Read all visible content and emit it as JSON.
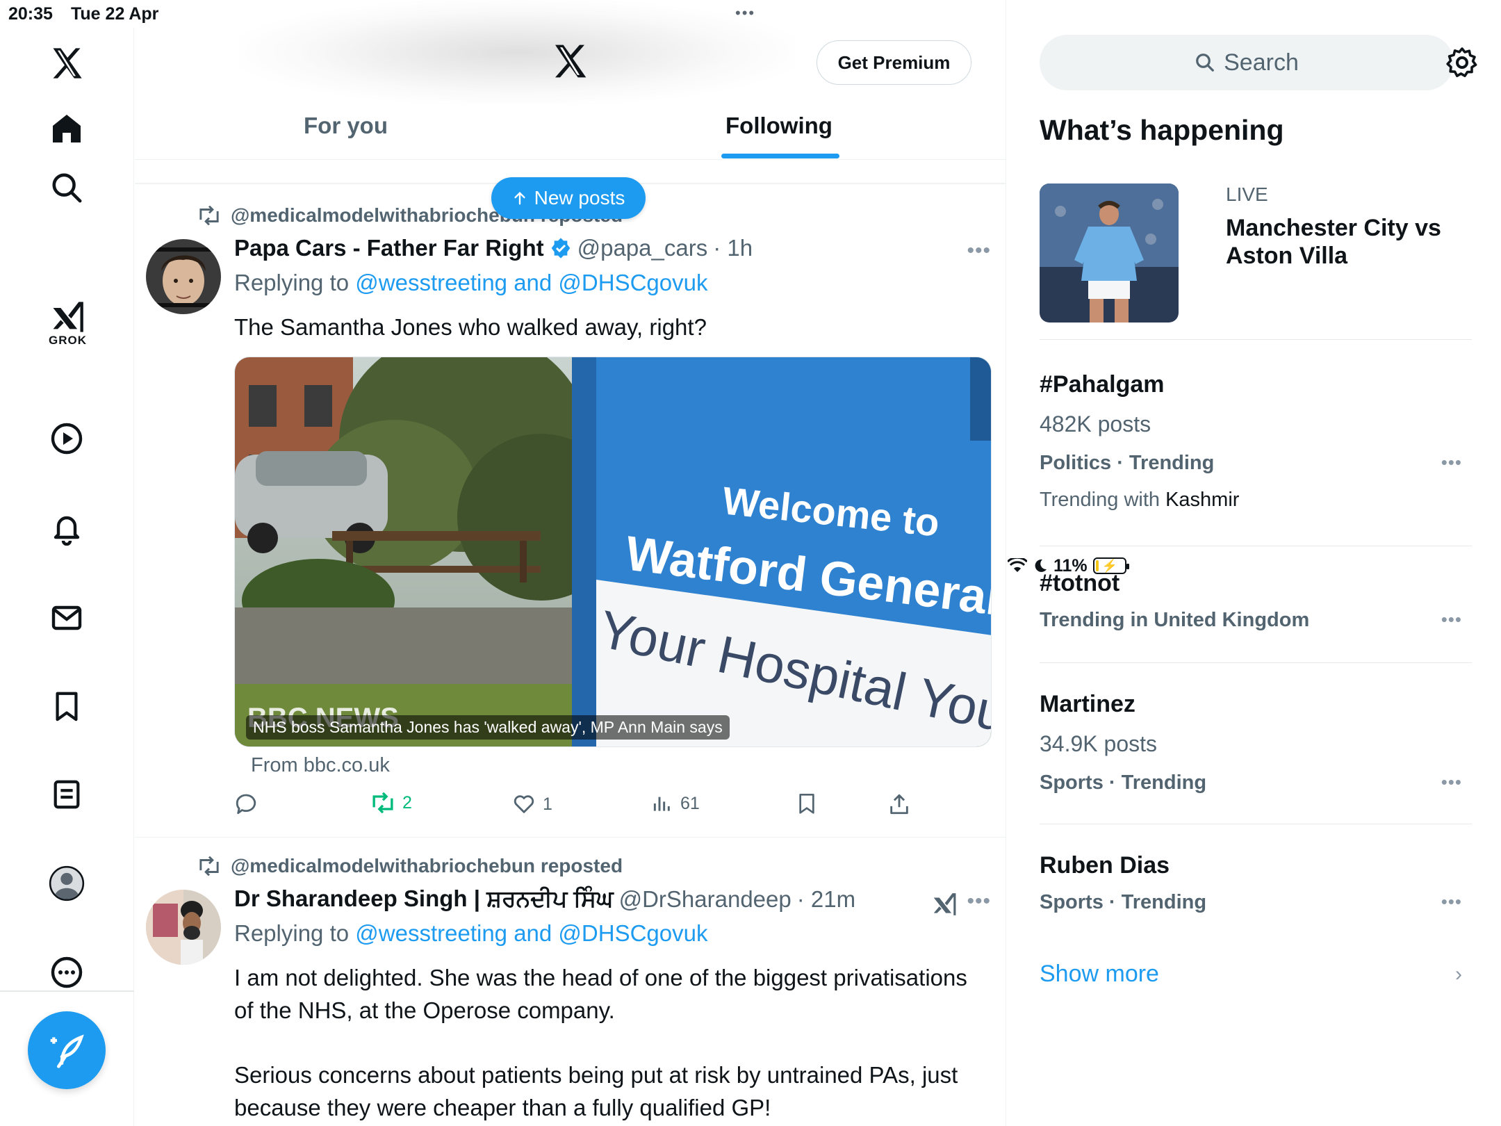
{
  "status_bar": {
    "time": "20:35",
    "date": "Tue 22 Apr",
    "battery": "11%",
    "battery_level": 0.11
  },
  "left_nav": {
    "grok_label": "GROK"
  },
  "header": {
    "get_premium": "Get Premium",
    "tabs": [
      {
        "label": "For you",
        "active": false
      },
      {
        "label": "Following",
        "active": true
      }
    ],
    "new_posts": "New posts"
  },
  "tweets": [
    {
      "reposted_by": "@medicalmodelwithabriochebun reposted",
      "name": "Papa Cars - Father Far Right",
      "verified": true,
      "handle": "@papa_cars",
      "time": "· 1h",
      "replying_prefix": "Replying to",
      "replying_to": "@wesstreeting and @DHSCgovuk",
      "text": "The Samantha Jones who walked away, right?",
      "media": {
        "sign_line1": "Welcome to",
        "sign_line2": "Watford General Hospit",
        "sign_line3": "Your Hospital Your",
        "watermark": "BBC NEWS",
        "caption": "NHS boss Samantha Jones has 'walked away', MP Ann Main says"
      },
      "from": "From bbc.co.uk",
      "actions": {
        "replies": "",
        "retweets": "2",
        "likes": "1",
        "views": "61"
      }
    },
    {
      "reposted_by": "@medicalmodelwithabriochebun reposted",
      "name": "Dr Sharandeep Singh | ਸ਼ਰਨਦੀਪ ਸਿੰਘ",
      "handle": "@DrSharandeep",
      "time": "· 21m",
      "replying_prefix": "Replying to",
      "replying_to": "@wesstreeting and @DHSCgovuk",
      "text_p1": "I am not delighted. She was the head of one of the biggest privatisations of the NHS, at the Operose company.",
      "text_p2": "Serious concerns about patients being put at risk by untrained PAs, just because they were cheaper than a fully qualified GP!"
    }
  ],
  "right": {
    "search_placeholder": "Search",
    "whats_happening": "What’s happening",
    "live": {
      "label": "LIVE",
      "title": "Manchester City vs Aston Villa"
    },
    "trends": [
      {
        "tag": "#Pahalgam",
        "count": "482K posts",
        "category": "Politics · Trending",
        "with_prefix": "Trending with",
        "with_value": "Kashmir"
      },
      {
        "tag": "#totnot",
        "category": "Trending in United Kingdom"
      },
      {
        "tag": "Martinez",
        "count": "34.9K posts",
        "category": "Sports · Trending"
      },
      {
        "tag": "Ruben Dias",
        "category": "Sports · Trending"
      }
    ],
    "show_more": "Show more"
  },
  "colors": {
    "accent": "#1d9bf0",
    "retweet_green": "#00ba7c",
    "secondary_text": "#536471"
  },
  "icons": [
    "x-logo-icon",
    "home-icon",
    "search-icon",
    "grok-icon",
    "video-icon",
    "bell-icon",
    "mail-icon",
    "bookmark-icon",
    "list-icon",
    "profile-icon",
    "more-icon",
    "compose-icon",
    "settings-icon",
    "reply-icon",
    "retweet-icon",
    "like-icon",
    "views-icon",
    "share-icon",
    "verified-icon"
  ]
}
